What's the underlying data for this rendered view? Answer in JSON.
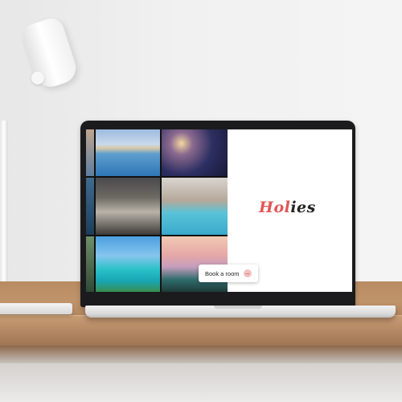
{
  "brand": {
    "logo_part1": "Hol",
    "logo_part2": "ies",
    "accent_color": "#e25656"
  },
  "hero": {
    "cta_label": "Book a room",
    "cta_icon": "arrow-right-icon"
  },
  "gallery": {
    "tiles": [
      "pool-resort",
      "restaurant-night",
      "bedroom",
      "villa-pool",
      "beach-bungalows",
      "sunset-palms"
    ]
  }
}
